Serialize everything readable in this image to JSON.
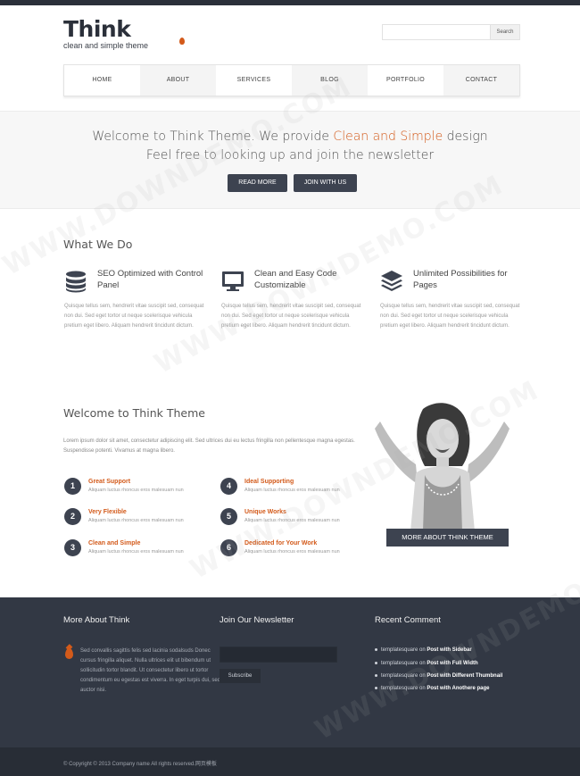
{
  "logo": {
    "word": "Think",
    "tagline": "clean and simple theme"
  },
  "search": {
    "value": "",
    "button": "Search"
  },
  "nav": {
    "items": [
      "HOME",
      "ABOUT",
      "SERVICES",
      "BLOG",
      "PORTFOLIO",
      "CONTACT"
    ]
  },
  "hero": {
    "line1_prefix": "Welcome to Think Theme. We provide ",
    "line1_accent": "Clean and Simple",
    "line1_suffix": " design",
    "line2": "Feel free to looking up and join the newsletter",
    "button_primary": "READ MORE",
    "button_secondary": "JOIN WITH US"
  },
  "what_we_do": {
    "title": "What We Do",
    "features": [
      {
        "icon": "database-icon",
        "title": "SEO Optimized with Control Panel",
        "body": "Quisque tellus sem, hendrerit vitae suscipit sed, consequat non dui. Sed eget tortor ut neque scelerisque vehicula pretium eget libero. Aliquam hendrerit tincidunt dictum."
      },
      {
        "icon": "monitor-icon",
        "title": "Clean and Easy Code Customizable",
        "body": "Quisque tellus sem, hendrerit vitae suscipit sed, consequat non dui. Sed eget tortor ut neque scelerisque vehicula pretium eget libero. Aliquam hendrerit tincidunt dictum."
      },
      {
        "icon": "layers-icon",
        "title": "Unlimited Possibilities for Pages",
        "body": "Quisque tellus sem, hendrerit vitae suscipit sed, consequat non dui. Sed eget tortor ut neque scelerisque vehicula pretium eget libero. Aliquam hendrerit tincidunt dictum."
      }
    ]
  },
  "welcome": {
    "title": "Welcome to Think Theme",
    "intro": "Lorem ipsum dolor sit amet, consectetur adipiscing elit. Sed ultrices dui eu lectus fringilla non pellentesque magna egestas. Suspendisse potenti. Vivamus at magna libero.",
    "points": [
      {
        "num": "1",
        "title": "Great Support",
        "body": "Aliquam luctus rhoncus eros malesuam nun"
      },
      {
        "num": "2",
        "title": "Very Flexible",
        "body": "Aliquam luctus rhoncus eros malesuam nun"
      },
      {
        "num": "3",
        "title": "Clean and Simple",
        "body": "Aliquam luctus rhoncus eros malesuam nun"
      },
      {
        "num": "4",
        "title": "Ideal Supporting",
        "body": "Aliquam luctus rhoncus eros malesuam nun"
      },
      {
        "num": "5",
        "title": "Unique Works",
        "body": "Aliquam luctus rhoncus eros malesuam nun"
      },
      {
        "num": "6",
        "title": "Dedicated for Your Work",
        "body": "Aliquam luctus rhoncus eros malesuam nun"
      }
    ],
    "more_button": "MORE ABOUT THINK THEME"
  },
  "footer": {
    "about_title": "More About Think",
    "about_text": "Sed convallis sagittis felis sed lacinia sodalsuds Donec cursus fringilla aliquet. Nulla ultrices elit ut bibendum ut sollicitudin tortor blandit. Ut consectetur libero ut tortor condimentum eu egestas est viverra. In eget turpis dui, sed auctor nisi.",
    "newsletter_title": "Join Our Newsletter",
    "newsletter_button": "Subscribe",
    "comments_title": "Recent Comment",
    "comments": [
      {
        "author": "templatesquare",
        "on": "on",
        "post": "Post with Sidebar"
      },
      {
        "author": "templatesquare",
        "on": "on",
        "post": "Post with Full Width"
      },
      {
        "author": "templatesquare",
        "on": "on",
        "post": "Post with Different Thumbnail"
      },
      {
        "author": "templatesquare",
        "on": "on",
        "post": "Post with Anothere page"
      }
    ],
    "copyright": "© Copyright © 2013 Company name All rights reserved.网页模板"
  },
  "watermark": "WWW.DOWNDEMO.COM",
  "colors": {
    "accent": "#d35a1a",
    "dark": "#323844",
    "button": "#3d4350"
  }
}
